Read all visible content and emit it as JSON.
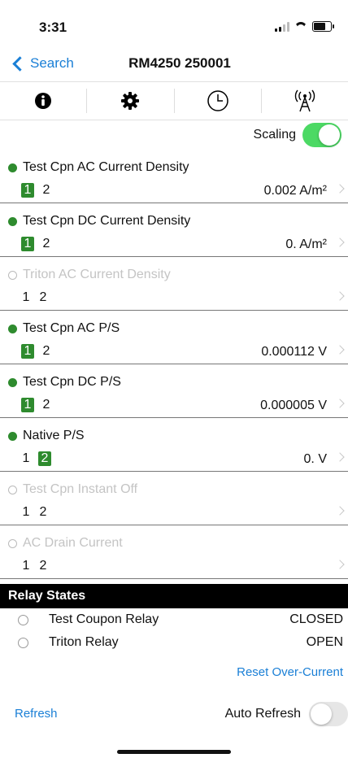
{
  "status": {
    "time": "3:31"
  },
  "nav": {
    "back_label": "Search",
    "title": "RM4250 250001"
  },
  "toolbar": {
    "icons": [
      "info-icon",
      "gear-icon",
      "clock-icon",
      "antenna-icon"
    ]
  },
  "scaling": {
    "label": "Scaling",
    "on": true
  },
  "items": [
    {
      "name": "Test Cpn AC Current Density",
      "active": true,
      "channels": [
        "1",
        "2"
      ],
      "selected": 1,
      "value": "0.002 A/m²"
    },
    {
      "name": "Test Cpn DC Current Density",
      "active": true,
      "channels": [
        "1",
        "2"
      ],
      "selected": 1,
      "value": "0. A/m²"
    },
    {
      "name": "Triton AC Current Density",
      "active": false,
      "channels": [
        "1",
        "2"
      ],
      "selected": 0,
      "value": ""
    },
    {
      "name": "Test Cpn AC P/S",
      "active": true,
      "channels": [
        "1",
        "2"
      ],
      "selected": 1,
      "value": "0.000112 V"
    },
    {
      "name": "Test Cpn DC P/S",
      "active": true,
      "channels": [
        "1",
        "2"
      ],
      "selected": 1,
      "value": "0.000005 V"
    },
    {
      "name": "Native P/S",
      "active": true,
      "channels": [
        "1",
        "2"
      ],
      "selected": 2,
      "value": "0. V"
    },
    {
      "name": "Test Cpn Instant Off",
      "active": false,
      "channels": [
        "1",
        "2"
      ],
      "selected": 0,
      "value": ""
    },
    {
      "name": "AC Drain Current",
      "active": false,
      "channels": [
        "1",
        "2"
      ],
      "selected": 0,
      "value": ""
    }
  ],
  "relay": {
    "header": "Relay States",
    "rows": [
      {
        "name": "Test Coupon Relay",
        "state": "CLOSED"
      },
      {
        "name": "Triton Relay",
        "state": "OPEN"
      }
    ]
  },
  "actions": {
    "reset_label": "Reset Over-Current",
    "refresh_label": "Refresh",
    "auto_refresh_label": "Auto Refresh",
    "auto_refresh_on": false
  }
}
